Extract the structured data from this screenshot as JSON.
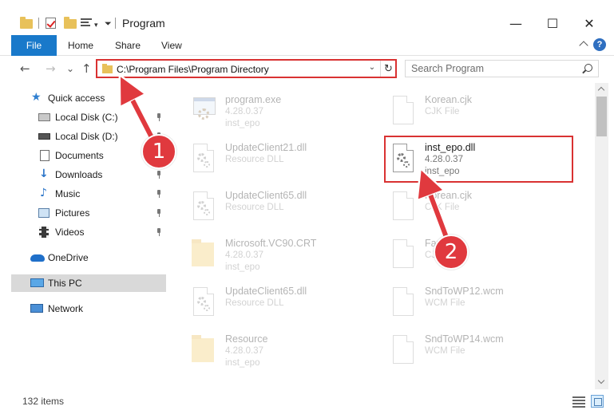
{
  "window": {
    "title": "Program",
    "minimize_glyph": "—",
    "maximize_glyph": "☐",
    "close_glyph": "✕"
  },
  "ribbon": {
    "file_tab": "File",
    "tabs": [
      "Home",
      "Share",
      "View"
    ],
    "help_glyph": "?"
  },
  "address": {
    "path": "C:\\Program Files\\Program Directory",
    "back_glyph": "←",
    "forward_glyph": "→",
    "recent_glyph": "⌄",
    "up_glyph": "↑",
    "dropdown_glyph": "⌄",
    "refresh_glyph": "↻"
  },
  "search": {
    "placeholder": "Search Program"
  },
  "nav": {
    "items": [
      {
        "label": "Quick access",
        "icon": "star-icon"
      },
      {
        "label": "Local Disk (C:)",
        "icon": "drive-icon",
        "pinned": true
      },
      {
        "label": "Local Disk (D:)",
        "icon": "drive-icon",
        "pinned": true
      },
      {
        "label": "Documents",
        "icon": "documents-icon",
        "pinned": true
      },
      {
        "label": "Downloads",
        "icon": "download-icon",
        "pinned": true
      },
      {
        "label": "Music",
        "icon": "music-icon",
        "pinned": true
      },
      {
        "label": "Pictures",
        "icon": "pictures-icon",
        "pinned": true
      },
      {
        "label": "Videos",
        "icon": "videos-icon",
        "pinned": true
      },
      {
        "label": "OneDrive",
        "icon": "cloud-icon"
      },
      {
        "label": "This PC",
        "icon": "computer-icon",
        "selected": true
      },
      {
        "label": "Network",
        "icon": "network-icon"
      }
    ]
  },
  "files": {
    "left": [
      {
        "name": "program.exe",
        "line2": "4.28.0.37",
        "line3": "inst_epo",
        "icon": "exe-icon"
      },
      {
        "name": "UpdateClient21.dll",
        "line2": "Resource DLL",
        "line3": "",
        "icon": "dll-icon"
      },
      {
        "name": "UpdateClient65.dll",
        "line2": "Resource DLL",
        "line3": "",
        "icon": "dll-icon"
      },
      {
        "name": "Microsoft.VC90.CRT",
        "line2": "4.28.0.37",
        "line3": "inst_epo",
        "icon": "folder-file-icon"
      },
      {
        "name": "UpdateClient65.dll",
        "line2": "Resource DLL",
        "line3": "",
        "icon": "dll-icon"
      },
      {
        "name": "Resource",
        "line2": "4.28.0.37",
        "line3": "inst_epo",
        "icon": "folder-file-icon"
      }
    ],
    "right": [
      {
        "name": "Korean.cjk",
        "line2": "CJK File",
        "line3": "",
        "icon": "blank-file-icon"
      },
      {
        "name": "inst_epo.dll",
        "line2": "4.28.0.37",
        "line3": "inst_epo",
        "icon": "dll-icon",
        "highlighted": true
      },
      {
        "name": "Korean.cjk",
        "line2": "CJK File",
        "line3": "",
        "icon": "blank-file-icon"
      },
      {
        "name": "Farsi.cjk",
        "line2": "CJK File",
        "line3": "",
        "icon": "blank-file-icon"
      },
      {
        "name": "SndToWP12.wcm",
        "line2": "WCM File",
        "line3": "",
        "icon": "blank-file-icon"
      },
      {
        "name": "SndToWP14.wcm",
        "line2": "WCM File",
        "line3": "",
        "icon": "blank-file-icon"
      }
    ]
  },
  "status": {
    "item_count": "132 items"
  },
  "annotations": {
    "step1": "1",
    "step2": "2",
    "accent_color": "#e0393e"
  }
}
